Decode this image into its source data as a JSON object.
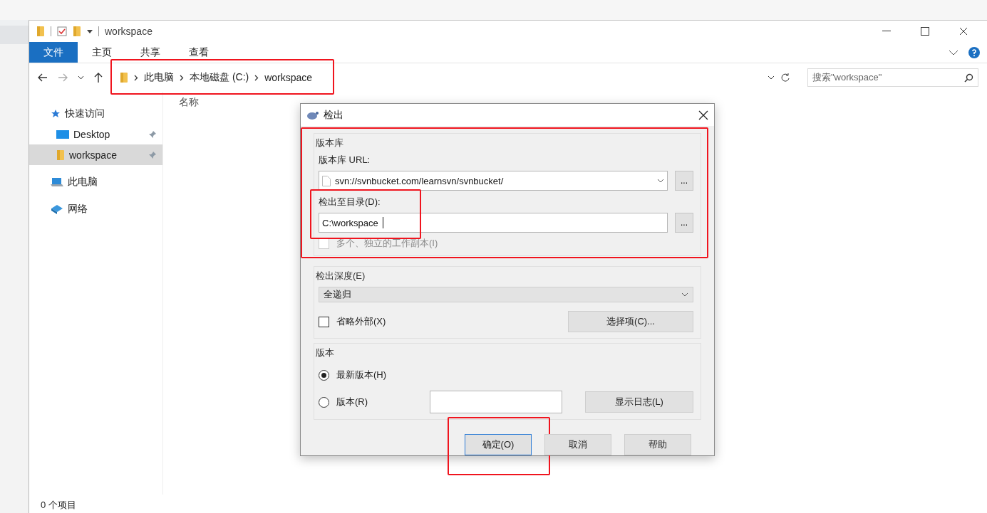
{
  "explorer": {
    "title": "workspace",
    "ribbon_tabs": [
      {
        "label": "文件",
        "selected": true
      },
      {
        "label": "主页",
        "selected": false
      },
      {
        "label": "共享",
        "selected": false
      },
      {
        "label": "查看",
        "selected": false
      }
    ],
    "breadcrumb": {
      "items": [
        "此电脑",
        "本地磁盘 (C:)",
        "workspace"
      ],
      "highlighted": true
    },
    "search": {
      "placeholder": "搜索\"workspace\""
    },
    "sidebar": [
      {
        "label": "快速访问",
        "kind": "star",
        "selected": false,
        "children": [
          {
            "label": "Desktop",
            "kind": "desktop",
            "pinned": true,
            "selected": false
          },
          {
            "label": "workspace",
            "kind": "folder",
            "pinned": true,
            "selected": true
          }
        ]
      },
      {
        "label": "此电脑",
        "kind": "computer",
        "selected": false
      },
      {
        "label": "网络",
        "kind": "network",
        "selected": false
      }
    ],
    "columns": [
      "名称"
    ],
    "status_bar": "0 个项目"
  },
  "dialog": {
    "title": "检出",
    "repository": {
      "legend": "版本库",
      "highlighted": true,
      "url_label": "版本库 URL:",
      "url": "svn://svnbucket.com/learnsvn/svnbucket/",
      "url_browse": "...",
      "target_label": "检出至目录(D):",
      "target": "C:\\workspace",
      "target_highlighted": true,
      "target_browse": "...",
      "multiple": {
        "label": "多个、独立的工作副本(I)",
        "checked": false,
        "disabled": true
      }
    },
    "depth": {
      "legend": "检出深度(E)",
      "value": "全递归",
      "omit_externals": {
        "label": "省略外部(X)",
        "checked": false,
        "disabled": false
      },
      "options_button": "选择项(C)..."
    },
    "revision": {
      "legend": "版本",
      "options": [
        {
          "label": "最新版本(H)",
          "selected": true
        },
        {
          "label": "版本(R)",
          "selected": false
        }
      ],
      "show_log_button": "显示日志(L)"
    },
    "buttons": [
      {
        "label": "确定(O)",
        "default": true,
        "highlighted": true
      },
      {
        "label": "取消",
        "default": false,
        "highlighted": false
      },
      {
        "label": "帮助",
        "default": false,
        "highlighted": false
      }
    ]
  }
}
